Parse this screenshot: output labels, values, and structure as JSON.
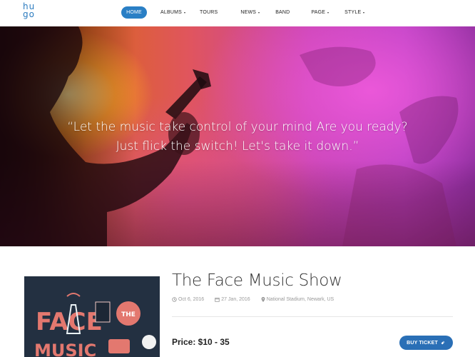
{
  "logo": {
    "line1": "hu",
    "line2": "go"
  },
  "nav": {
    "items": [
      {
        "label": "HOME",
        "active": true,
        "dropdown": false
      },
      {
        "label": "ALBUMS",
        "active": false,
        "dropdown": true
      },
      {
        "label": "TOURS",
        "active": false,
        "dropdown": false
      },
      {
        "label": "NEWS",
        "active": false,
        "dropdown": true
      },
      {
        "label": "BAND",
        "active": false,
        "dropdown": false
      },
      {
        "label": "PAGE",
        "active": false,
        "dropdown": true
      },
      {
        "label": "STYLE",
        "active": false,
        "dropdown": true
      }
    ]
  },
  "hero": {
    "quote_line1": "“Let the music take control of your mind  Are you ready?",
    "quote_line2": "Just flick the switch! Let's take it down.”"
  },
  "event": {
    "title": "The Face Music Show",
    "date": "Oct 6, 2016",
    "calendar_date": "27 Jan, 2016",
    "location": "National Stadium, Newark, US",
    "price": "Price: $10 - 35",
    "buy_label": "BUY TICKET"
  },
  "album_art": {
    "word1": "FACE",
    "word2": "THE",
    "word3": "MUSIC"
  },
  "colors": {
    "accent": "#2a7fc5",
    "button": "#2a6fb6",
    "album_bg": "#233041"
  }
}
